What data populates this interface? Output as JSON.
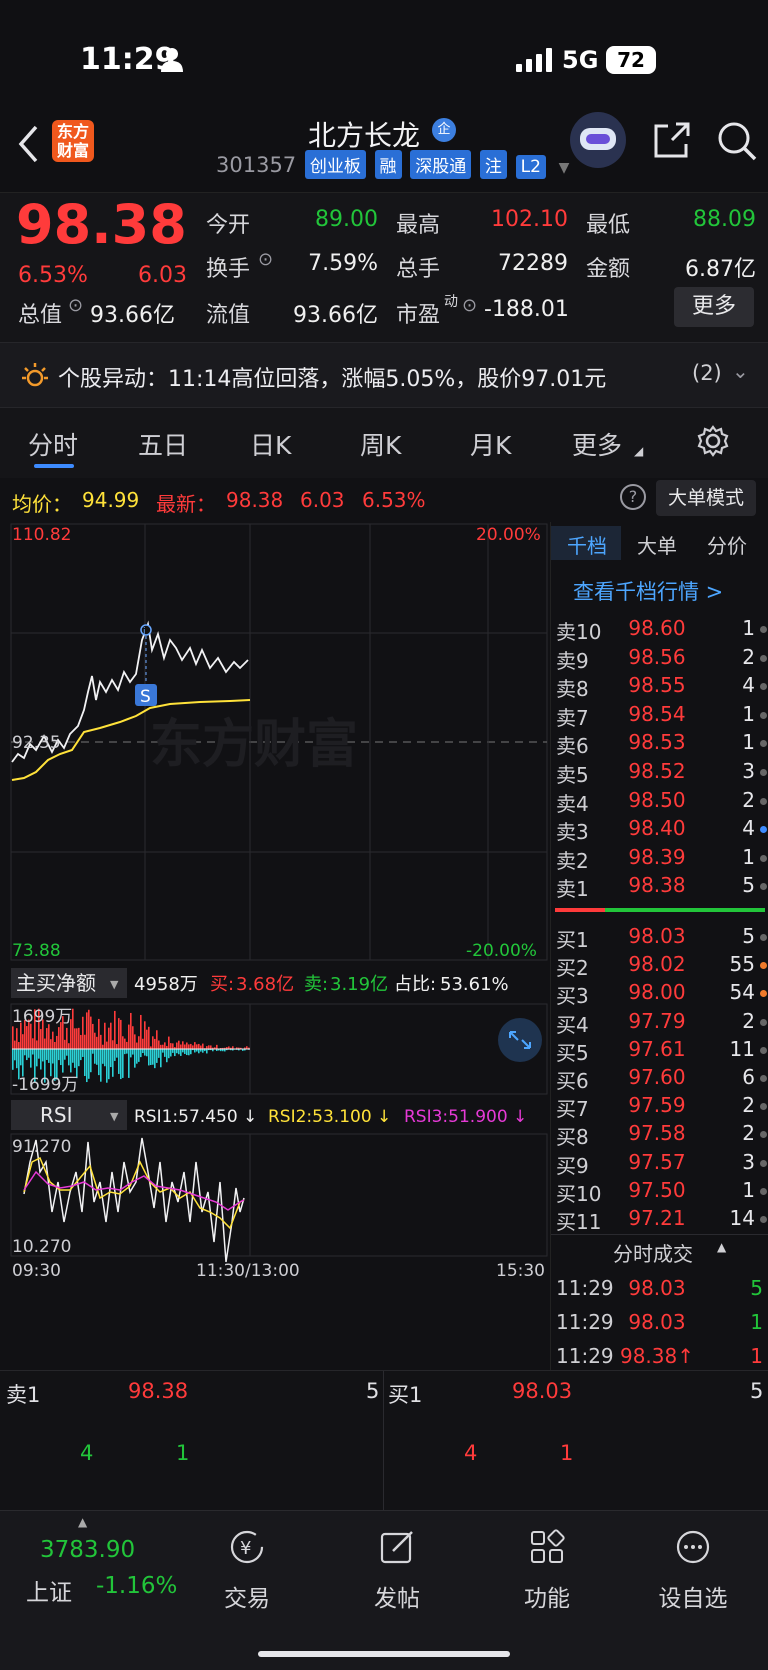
{
  "status": {
    "time": "11:29",
    "network": "5G",
    "battery": "72"
  },
  "nav": {
    "logo_line1": "东方",
    "logo_line2": "财富",
    "stock_name": "北方长龙",
    "ent_badge": "企",
    "code": "301357",
    "tags": [
      "创业板",
      "融",
      "深股通",
      "注",
      "L2"
    ]
  },
  "quote": {
    "price": "98.38",
    "change_pct": "6.53%",
    "change": "6.03",
    "open_label": "今开",
    "open": "89.00",
    "high_label": "最高",
    "high": "102.10",
    "low_label": "最低",
    "low": "88.09",
    "turnover_label": "换手",
    "turnover": "7.59%",
    "volume_label": "总手",
    "volume": "72289",
    "amount_label": "金额",
    "amount": "6.87亿",
    "mcap_label": "总值",
    "mcap": "93.66亿",
    "float_label": "流值",
    "float_mcap": "93.66亿",
    "pe_label": "市盈",
    "pe_sup": "动",
    "pe": "-188.01",
    "more_button": "更多"
  },
  "alert": {
    "text": "个股异动：11:14高位回落，涨幅5.05%，股价97.01元",
    "count": "(2)"
  },
  "tabs": [
    "分时",
    "五日",
    "日K",
    "周K",
    "月K",
    "更多"
  ],
  "infoline": {
    "avg_label": "均价：",
    "avg": "94.99",
    "latest_label": "最新：",
    "latest": "98.38",
    "latest_change": "6.03",
    "latest_pct": "6.53%",
    "help": "?",
    "big_order_button": "大单模式"
  },
  "main_chart": {
    "y_top": "110.82",
    "y_mid": "92.35",
    "y_bottom": "73.88",
    "pct_top": "20.00%",
    "pct_bottom": "-20.00%",
    "watermark": "东方财富",
    "marker_s": "S",
    "marker_i": "i"
  },
  "flow_panel": {
    "selector": "主买净额",
    "value": "4958万",
    "buy_label": "买:",
    "buy": "3.68亿",
    "sell_label": "卖:",
    "sell": "3.19亿",
    "ratio_label": "占比:",
    "ratio": "53.61%",
    "y_top": "1699万",
    "y_bottom": "-1699万"
  },
  "rsi_panel": {
    "selector": "RSI",
    "rsi1": "RSI1:57.450 ↓",
    "rsi2": "RSI2:53.100 ↓",
    "rsi3": "RSI3:51.900 ↓",
    "y_top": "91.270",
    "y_bottom": "10.270"
  },
  "time_axis": [
    "09:30",
    "11:30/13:00",
    "15:30"
  ],
  "orderbook": {
    "tabs": [
      "千档",
      "大单",
      "分价"
    ],
    "link": "查看千档行情 >",
    "asks": [
      {
        "label": "卖10",
        "price": "98.60",
        "vol": "1"
      },
      {
        "label": "卖9",
        "price": "98.56",
        "vol": "2"
      },
      {
        "label": "卖8",
        "price": "98.55",
        "vol": "4"
      },
      {
        "label": "卖7",
        "price": "98.54",
        "vol": "1"
      },
      {
        "label": "卖6",
        "price": "98.53",
        "vol": "1"
      },
      {
        "label": "卖5",
        "price": "98.52",
        "vol": "3"
      },
      {
        "label": "卖4",
        "price": "98.50",
        "vol": "2"
      },
      {
        "label": "卖3",
        "price": "98.40",
        "vol": "4"
      },
      {
        "label": "卖2",
        "price": "98.39",
        "vol": "1"
      },
      {
        "label": "卖1",
        "price": "98.38",
        "vol": "5"
      }
    ],
    "bids": [
      {
        "label": "买1",
        "price": "98.03",
        "vol": "5"
      },
      {
        "label": "买2",
        "price": "98.02",
        "vol": "55"
      },
      {
        "label": "买3",
        "price": "98.00",
        "vol": "54"
      },
      {
        "label": "买4",
        "price": "97.79",
        "vol": "2"
      },
      {
        "label": "买5",
        "price": "97.61",
        "vol": "11"
      },
      {
        "label": "买6",
        "price": "97.60",
        "vol": "6"
      },
      {
        "label": "买7",
        "price": "97.59",
        "vol": "2"
      },
      {
        "label": "买8",
        "price": "97.58",
        "vol": "2"
      },
      {
        "label": "买9",
        "price": "97.57",
        "vol": "3"
      },
      {
        "label": "买10",
        "price": "97.50",
        "vol": "1"
      },
      {
        "label": "买11",
        "price": "97.21",
        "vol": "14"
      }
    ],
    "ticks_title": "分时成交",
    "ticks": [
      {
        "time": "11:29",
        "price": "98.03",
        "vol": "5"
      },
      {
        "time": "11:29",
        "price": "98.03",
        "vol": "1"
      },
      {
        "time": "11:29",
        "price": "98.38↑",
        "vol": "1"
      }
    ]
  },
  "bottom_quote": {
    "left": {
      "label": "卖1",
      "price": "98.38",
      "vol": "5",
      "q1": "4",
      "q2": "1"
    },
    "right": {
      "label": "买1",
      "price": "98.03",
      "vol": "5",
      "q1": "4",
      "q2": "1"
    }
  },
  "bottom_nav": {
    "index_value": "3783.90",
    "index_name": "上证",
    "index_change": "-1.16%",
    "items": [
      "交易",
      "发帖",
      "功能",
      "设自选"
    ]
  },
  "colors": {
    "up": "#ff3b3b",
    "down": "#22c53a",
    "accent": "#2a6fd6",
    "background": "#111114"
  }
}
